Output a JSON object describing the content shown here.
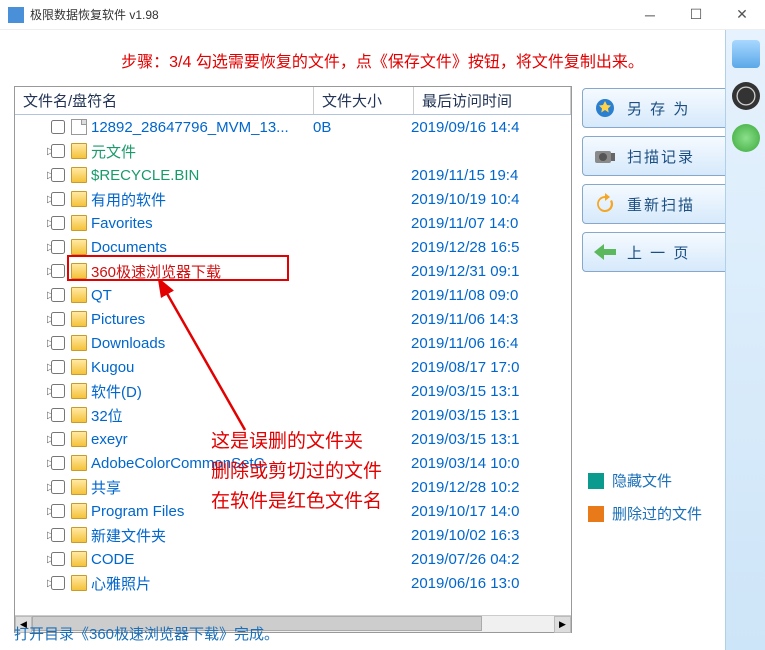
{
  "window": {
    "title": "极限数据恢复软件 v1.98"
  },
  "hint": "步骤：3/4 勾选需要恢复的文件，点《保存文件》按钮，将文件复制出来。",
  "columns": {
    "name": "文件名/盘符名",
    "size": "文件大小",
    "date": "最后访问时间"
  },
  "files": [
    {
      "name": "12892_28647796_MVM_13...",
      "size": "0B",
      "date": "2019/09/16 14:4",
      "type": "file",
      "style": "normal"
    },
    {
      "name": "元文件",
      "size": "",
      "date": "",
      "type": "folder",
      "style": "special"
    },
    {
      "name": "$RECYCLE.BIN",
      "size": "",
      "date": "2019/11/15 19:4",
      "type": "folder",
      "style": "special"
    },
    {
      "name": "有用的软件",
      "size": "",
      "date": "2019/10/19 10:4",
      "type": "folder",
      "style": "normal"
    },
    {
      "name": "Favorites",
      "size": "",
      "date": "2019/11/07 14:0",
      "type": "folder",
      "style": "normal"
    },
    {
      "name": "Documents",
      "size": "",
      "date": "2019/12/28 16:5",
      "type": "folder",
      "style": "normal"
    },
    {
      "name": "360极速浏览器下载",
      "size": "",
      "date": "2019/12/31 09:1",
      "type": "folder",
      "style": "deleted"
    },
    {
      "name": "QT",
      "size": "",
      "date": "2019/11/08 09:0",
      "type": "folder",
      "style": "normal"
    },
    {
      "name": "Pictures",
      "size": "",
      "date": "2019/11/06 14:3",
      "type": "folder",
      "style": "normal"
    },
    {
      "name": "Downloads",
      "size": "",
      "date": "2019/11/06 16:4",
      "type": "folder",
      "style": "normal"
    },
    {
      "name": "Kugou",
      "size": "",
      "date": "2019/08/17 17:0",
      "type": "folder",
      "style": "normal"
    },
    {
      "name": "软件(D)",
      "size": "",
      "date": "2019/03/15 13:1",
      "type": "folder",
      "style": "normal"
    },
    {
      "name": "32位",
      "size": "",
      "date": "2019/03/15 13:1",
      "type": "folder",
      "style": "normal"
    },
    {
      "name": "exeyr",
      "size": "",
      "date": "2019/03/15 13:1",
      "type": "folder",
      "style": "normal"
    },
    {
      "name": "AdobeColorCommonSetC...",
      "size": "",
      "date": "2019/03/14 10:0",
      "type": "folder",
      "style": "normal"
    },
    {
      "name": "共享",
      "size": "",
      "date": "2019/12/28 10:2",
      "type": "folder",
      "style": "normal"
    },
    {
      "name": "Program Files",
      "size": "",
      "date": "2019/10/17 14:0",
      "type": "folder",
      "style": "normal"
    },
    {
      "name": "新建文件夹",
      "size": "",
      "date": "2019/10/02 16:3",
      "type": "folder",
      "style": "normal"
    },
    {
      "name": "CODE",
      "size": "",
      "date": "2019/07/26 04:2",
      "type": "folder",
      "style": "normal"
    },
    {
      "name": "心雅照片",
      "size": "",
      "date": "2019/06/16 13:0",
      "type": "folder",
      "style": "normal"
    }
  ],
  "annotation": {
    "line1": "这是误删的文件夹",
    "line2": "删除或剪切过的文件",
    "line3": "在软件是红色文件名"
  },
  "buttons": {
    "save_as": "另 存 为",
    "scan_log": "扫描记录",
    "rescan": "重新扫描",
    "back": "上 一 页"
  },
  "legend": {
    "hidden": "隐藏文件",
    "deleted": "删除过的文件"
  },
  "status": "打开目录《360极速浏览器下载》完成。"
}
